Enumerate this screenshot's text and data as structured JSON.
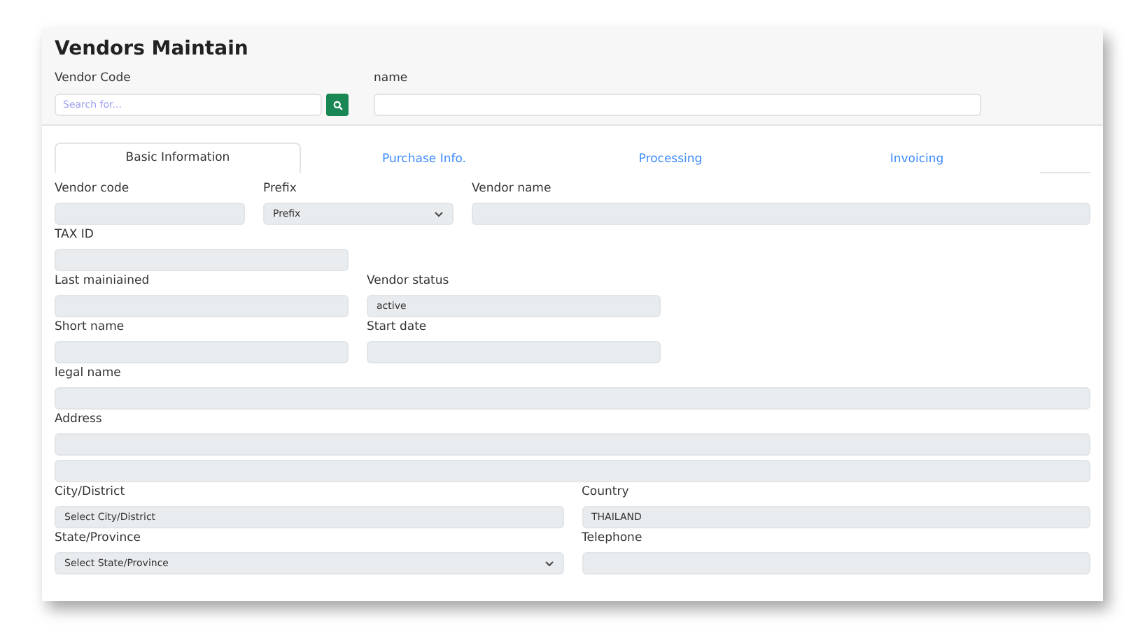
{
  "title": "Vendors Maintain",
  "search": [
    {
      "label": "Vendor Code",
      "placeholder": "Search for..."
    },
    {
      "label": "name"
    }
  ],
  "tabs": [
    {
      "label": "Basic Information",
      "selected": true
    },
    {
      "label": "Purchase Info.",
      "selected": false
    },
    {
      "label": "Processing",
      "selected": false
    },
    {
      "label": "Invoicing",
      "selected": false
    }
  ],
  "rows": [
    [
      {
        "label": "Vendor code",
        "kind": "text"
      },
      {
        "label": "Prefix",
        "kind": "select",
        "value": "Prefix"
      },
      {
        "label": "Vendor name",
        "kind": "text"
      }
    ],
    [
      {
        "label": "TAX ID",
        "kind": "text"
      }
    ],
    [
      {
        "label": "Last mainiained",
        "kind": "text"
      },
      {
        "label": "Vendor status",
        "kind": "text",
        "value": "active"
      }
    ],
    [
      {
        "label": "Short name",
        "kind": "text"
      },
      {
        "label": "Start date",
        "kind": "text"
      }
    ],
    [
      {
        "label": "legal name",
        "kind": "text"
      }
    ],
    [
      {
        "label": "Address",
        "kind": "double"
      }
    ],
    [
      {
        "label": "City/District",
        "kind": "text",
        "value": "Select City/District"
      },
      {
        "label": "Country",
        "kind": "text",
        "value": "THAILAND"
      }
    ],
    [
      {
        "label": "State/Province",
        "kind": "select",
        "value": "Select State/Province"
      },
      {
        "label": "Telephone",
        "kind": "text"
      }
    ]
  ]
}
